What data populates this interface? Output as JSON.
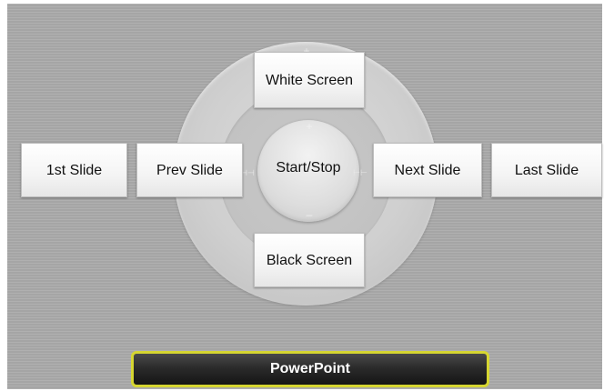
{
  "controls": {
    "white_screen": "White Screen",
    "black_screen": "Black Screen",
    "first_slide": "1st Slide",
    "prev_slide": "Prev Slide",
    "start_stop": "Start/Stop",
    "next_slide": "Next Slide",
    "last_slide": "Last Slide"
  },
  "footer": {
    "label": "PowerPoint"
  },
  "wheel_marks": {
    "plus": "+",
    "minus": "–",
    "left": "⊣⊣",
    "right": "⊢⊢"
  },
  "colors": {
    "background": "#a9a9a9",
    "footer_border": "#d6d631",
    "footer_fill": "#1e1e1e",
    "button_fill": "#f4f4f4"
  }
}
